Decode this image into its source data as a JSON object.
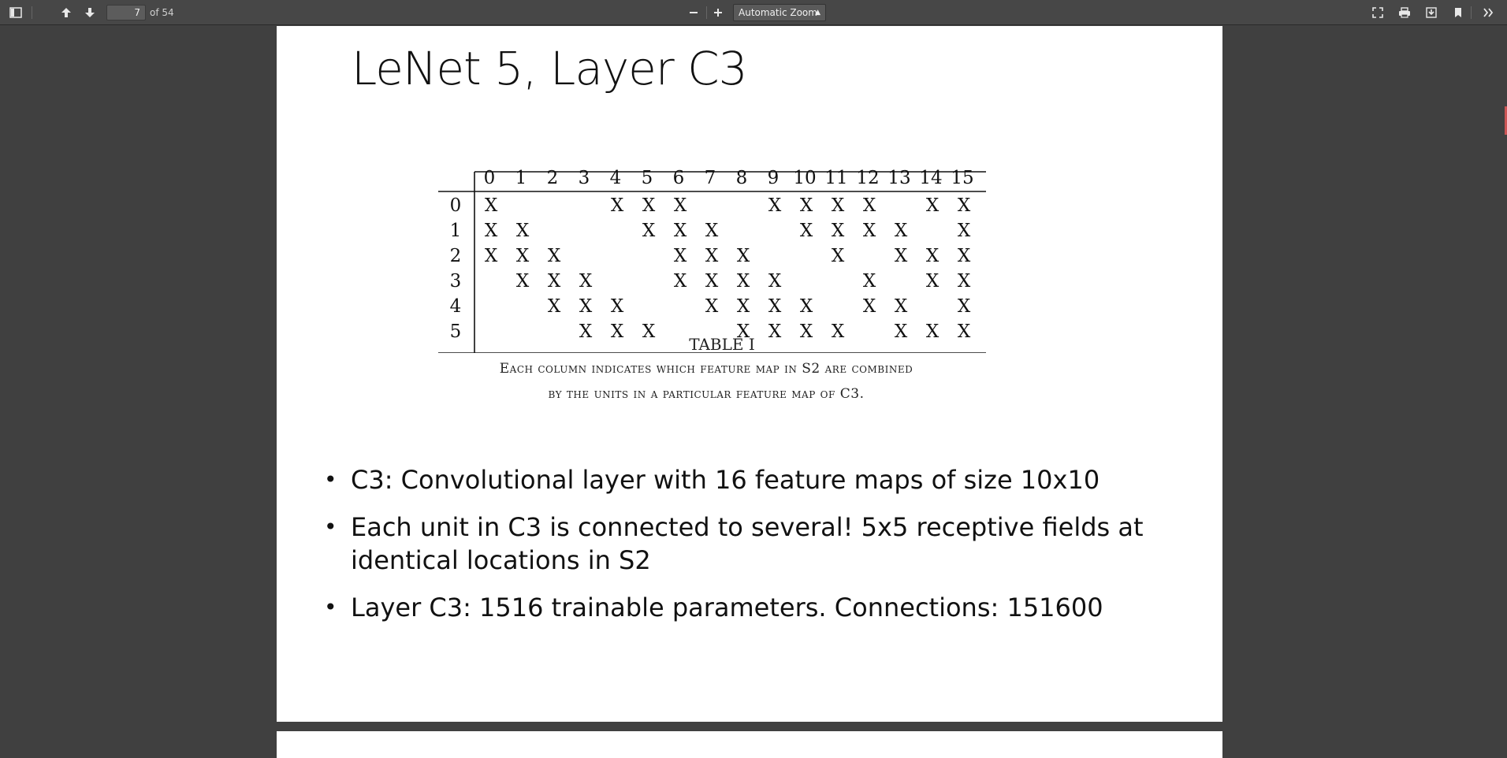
{
  "toolbar": {
    "page_number": "7",
    "page_count": "of 54",
    "zoom_value": "Automatic Zoom"
  },
  "slide": {
    "title": "LeNet 5, Layer C3",
    "table": {
      "columns": [
        "0",
        "1",
        "2",
        "3",
        "4",
        "5",
        "6",
        "7",
        "8",
        "9",
        "10",
        "11",
        "12",
        "13",
        "14",
        "15"
      ],
      "rows": [
        {
          "label": "0",
          "cells": [
            "X",
            "",
            "",
            "",
            "X",
            "X",
            "X",
            "",
            "",
            "X",
            "X",
            "X",
            "X",
            "",
            "X",
            "X"
          ]
        },
        {
          "label": "1",
          "cells": [
            "X",
            "X",
            "",
            "",
            "",
            "X",
            "X",
            "X",
            "",
            "",
            "X",
            "X",
            "X",
            "X",
            "",
            "X"
          ]
        },
        {
          "label": "2",
          "cells": [
            "X",
            "X",
            "X",
            "",
            "",
            "",
            "X",
            "X",
            "X",
            "",
            "",
            "X",
            "",
            "X",
            "X",
            "X"
          ]
        },
        {
          "label": "3",
          "cells": [
            "",
            "X",
            "X",
            "X",
            "",
            "",
            "X",
            "X",
            "X",
            "X",
            "",
            "",
            "X",
            "",
            "X",
            "X"
          ]
        },
        {
          "label": "4",
          "cells": [
            "",
            "",
            "X",
            "X",
            "X",
            "",
            "",
            "X",
            "X",
            "X",
            "X",
            "",
            "X",
            "X",
            "",
            "X"
          ]
        },
        {
          "label": "5",
          "cells": [
            "",
            "",
            "",
            "X",
            "X",
            "X",
            "",
            "",
            "X",
            "X",
            "X",
            "X",
            "",
            "X",
            "X",
            "X"
          ]
        }
      ],
      "caption_title": "TABLE I",
      "caption_line1": "Each column indicates which feature map in S2 are combined",
      "caption_line2": "by the units in a particular feature map of C3."
    },
    "bullets": [
      {
        "text": "C3: Convolutional layer with 16 feature maps of size 10x10"
      },
      {
        "text": "Each unit in C3 is connected to several! 5x5 receptive fields at identical locations in S2"
      },
      {
        "text": "Layer C3: 1516 trainable parameters. Connections: 151600"
      }
    ]
  }
}
